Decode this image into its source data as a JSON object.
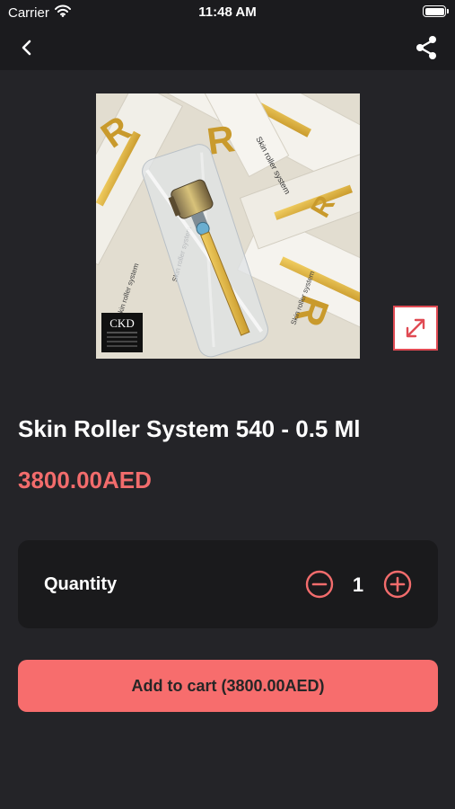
{
  "status_bar": {
    "carrier": "Carrier",
    "time": "11:48 AM",
    "wifi_icon": "wifi-icon",
    "battery_icon": "battery-icon"
  },
  "nav": {
    "back_icon": "chevron-left-icon",
    "share_icon": "share-icon"
  },
  "product": {
    "title": "Skin Roller System 540 - 0.5 Ml",
    "price": "3800.00AED",
    "image_box_text": "Skin roller system",
    "logo_text": "CKD",
    "expand_icon": "expand-icon"
  },
  "quantity": {
    "label": "Quantity",
    "value": "1",
    "minus_icon": "minus-circle-icon",
    "plus_icon": "plus-circle-icon"
  },
  "cart": {
    "button_label": "Add to cart (3800.00AED)"
  },
  "colors": {
    "background": "#242428",
    "accent": "#f76d6d",
    "price": "#f26c6c",
    "card": "#1a1a1c"
  }
}
